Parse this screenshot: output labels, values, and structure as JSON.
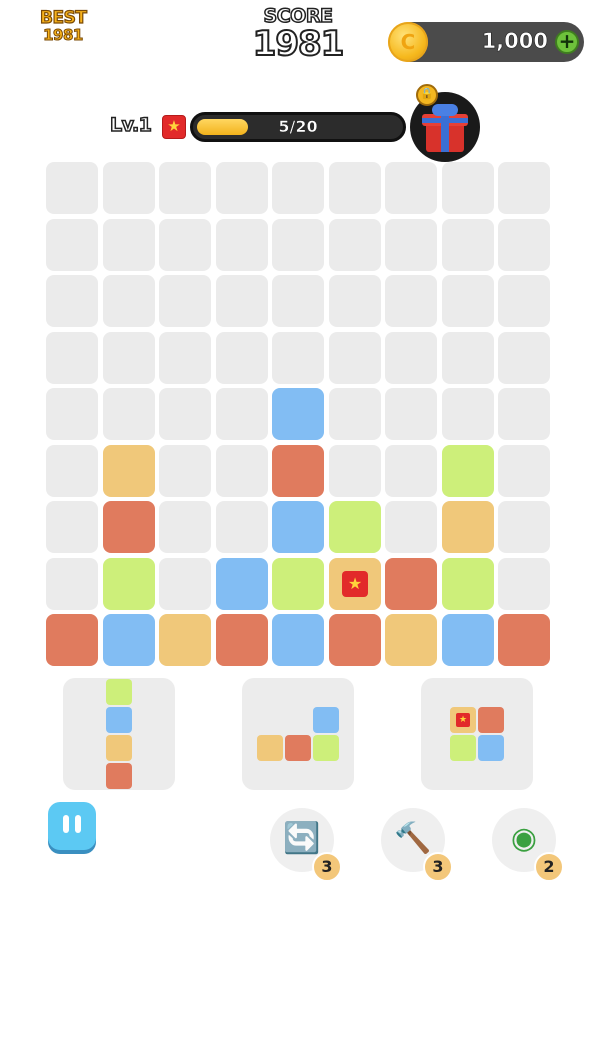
{
  "header": {
    "best_label": "BEST",
    "best_value": "1981",
    "score_label": "SCORE",
    "score_value": "1981",
    "coins": "1,000"
  },
  "level": {
    "label": "Lv.1",
    "progress_text": "5/20",
    "progress": 0.25
  },
  "colors": {
    "empty": "#ebebeb",
    "blue": "#82bdf3",
    "orange": "#f0c87a",
    "red": "#e07b5e",
    "green": "#cdef7a"
  },
  "board": {
    "rows": 9,
    "cols": 9,
    "cells": [
      [
        0,
        0,
        0,
        0,
        0,
        0,
        0,
        0,
        0
      ],
      [
        0,
        0,
        0,
        0,
        0,
        0,
        0,
        0,
        0
      ],
      [
        0,
        0,
        0,
        0,
        0,
        0,
        0,
        0,
        0
      ],
      [
        0,
        0,
        0,
        0,
        0,
        0,
        0,
        0,
        0
      ],
      [
        0,
        0,
        0,
        0,
        "B",
        0,
        0,
        0,
        0
      ],
      [
        0,
        "O",
        0,
        0,
        "R",
        0,
        0,
        "G",
        0
      ],
      [
        0,
        "R",
        0,
        0,
        "B",
        "G",
        0,
        "O",
        0
      ],
      [
        0,
        "G",
        0,
        "B",
        "G",
        "OS",
        "R",
        "G",
        0
      ],
      [
        "R",
        "B",
        "O",
        "R",
        "B",
        "R",
        "O",
        "B",
        "R"
      ]
    ]
  },
  "pieces": [
    {
      "blocks": [
        [
          0,
          0,
          "G"
        ],
        [
          0,
          1,
          "B"
        ],
        [
          0,
          2,
          "O"
        ],
        [
          0,
          3,
          "R"
        ]
      ]
    },
    {
      "blocks": [
        [
          2,
          0,
          "B"
        ],
        [
          0,
          1,
          "O"
        ],
        [
          1,
          1,
          "R"
        ],
        [
          2,
          1,
          "G"
        ]
      ]
    },
    {
      "blocks": [
        [
          0,
          0,
          "OS"
        ],
        [
          1,
          0,
          "R"
        ],
        [
          0,
          1,
          "G"
        ],
        [
          1,
          1,
          "B"
        ]
      ]
    }
  ],
  "tools": {
    "rotate": {
      "icon": "rotate-icon",
      "count": "3"
    },
    "hammer": {
      "icon": "hammer-icon",
      "count": "3"
    },
    "bomb": {
      "icon": "bomb-icon",
      "count": "2"
    }
  }
}
